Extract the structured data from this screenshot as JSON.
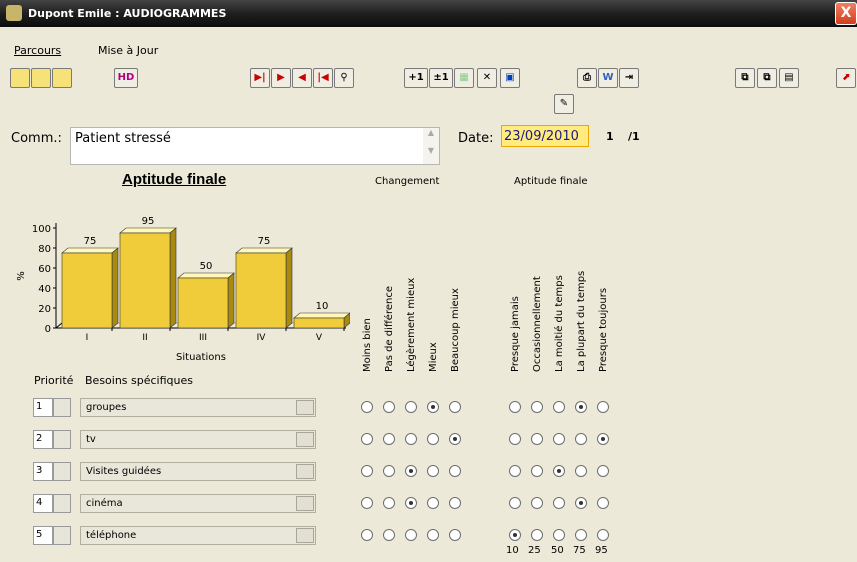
{
  "window": {
    "title": "Dupont Emile : AUDIOGRAMMES",
    "close": "X"
  },
  "menu": [
    {
      "label": "Parcours"
    },
    {
      "label": "Mise à Jour"
    }
  ],
  "toolbar": {
    "hd": "HD",
    "plus1a": "+1",
    "plus1b": "±1"
  },
  "comment": {
    "label": "Comm.:",
    "value": "Patient stressé"
  },
  "date": {
    "label": "Date:",
    "value": "23/09/2010"
  },
  "paging": {
    "current": "1",
    "total": "/1"
  },
  "chart_title": "Aptitude finale",
  "chart_data": {
    "type": "bar",
    "categories": [
      "I",
      "II",
      "III",
      "IV",
      "V"
    ],
    "values": [
      75,
      95,
      50,
      75,
      10
    ],
    "ylim": [
      0,
      100
    ],
    "yticks": [
      0,
      20,
      40,
      60,
      80,
      100
    ],
    "xlabel": "Situations",
    "ylabel": "%",
    "data_labels": [
      "75",
      "95",
      "50",
      "75",
      "10"
    ]
  },
  "sections": {
    "changement": "Changement",
    "aptitude": "Aptitude finale"
  },
  "columns": {
    "changement": [
      "Moins bien",
      "Pas de différence",
      "Légèrement mieux",
      "Mieux",
      "Beaucoup mieux"
    ],
    "aptitude": [
      "Presque jamais",
      "Occasionnellement",
      "La moitié du temps",
      "La plupart du temps",
      "Presque toujours"
    ]
  },
  "headers": {
    "priorite": "Priorité",
    "besoins": "Besoins spécifiques"
  },
  "rows": [
    {
      "prio": "1",
      "label": "groupes",
      "changement": 3,
      "aptitude": 3
    },
    {
      "prio": "2",
      "label": "tv",
      "changement": 4,
      "aptitude": 4
    },
    {
      "prio": "3",
      "label": "Visites guidées",
      "changement": 2,
      "aptitude": 2
    },
    {
      "prio": "4",
      "label": "cinéma",
      "changement": 2,
      "aptitude": 3
    },
    {
      "prio": "5",
      "label": "téléphone",
      "changement": -1,
      "aptitude": 0
    }
  ],
  "scale": [
    "10",
    "25",
    "50",
    "75",
    "95"
  ]
}
